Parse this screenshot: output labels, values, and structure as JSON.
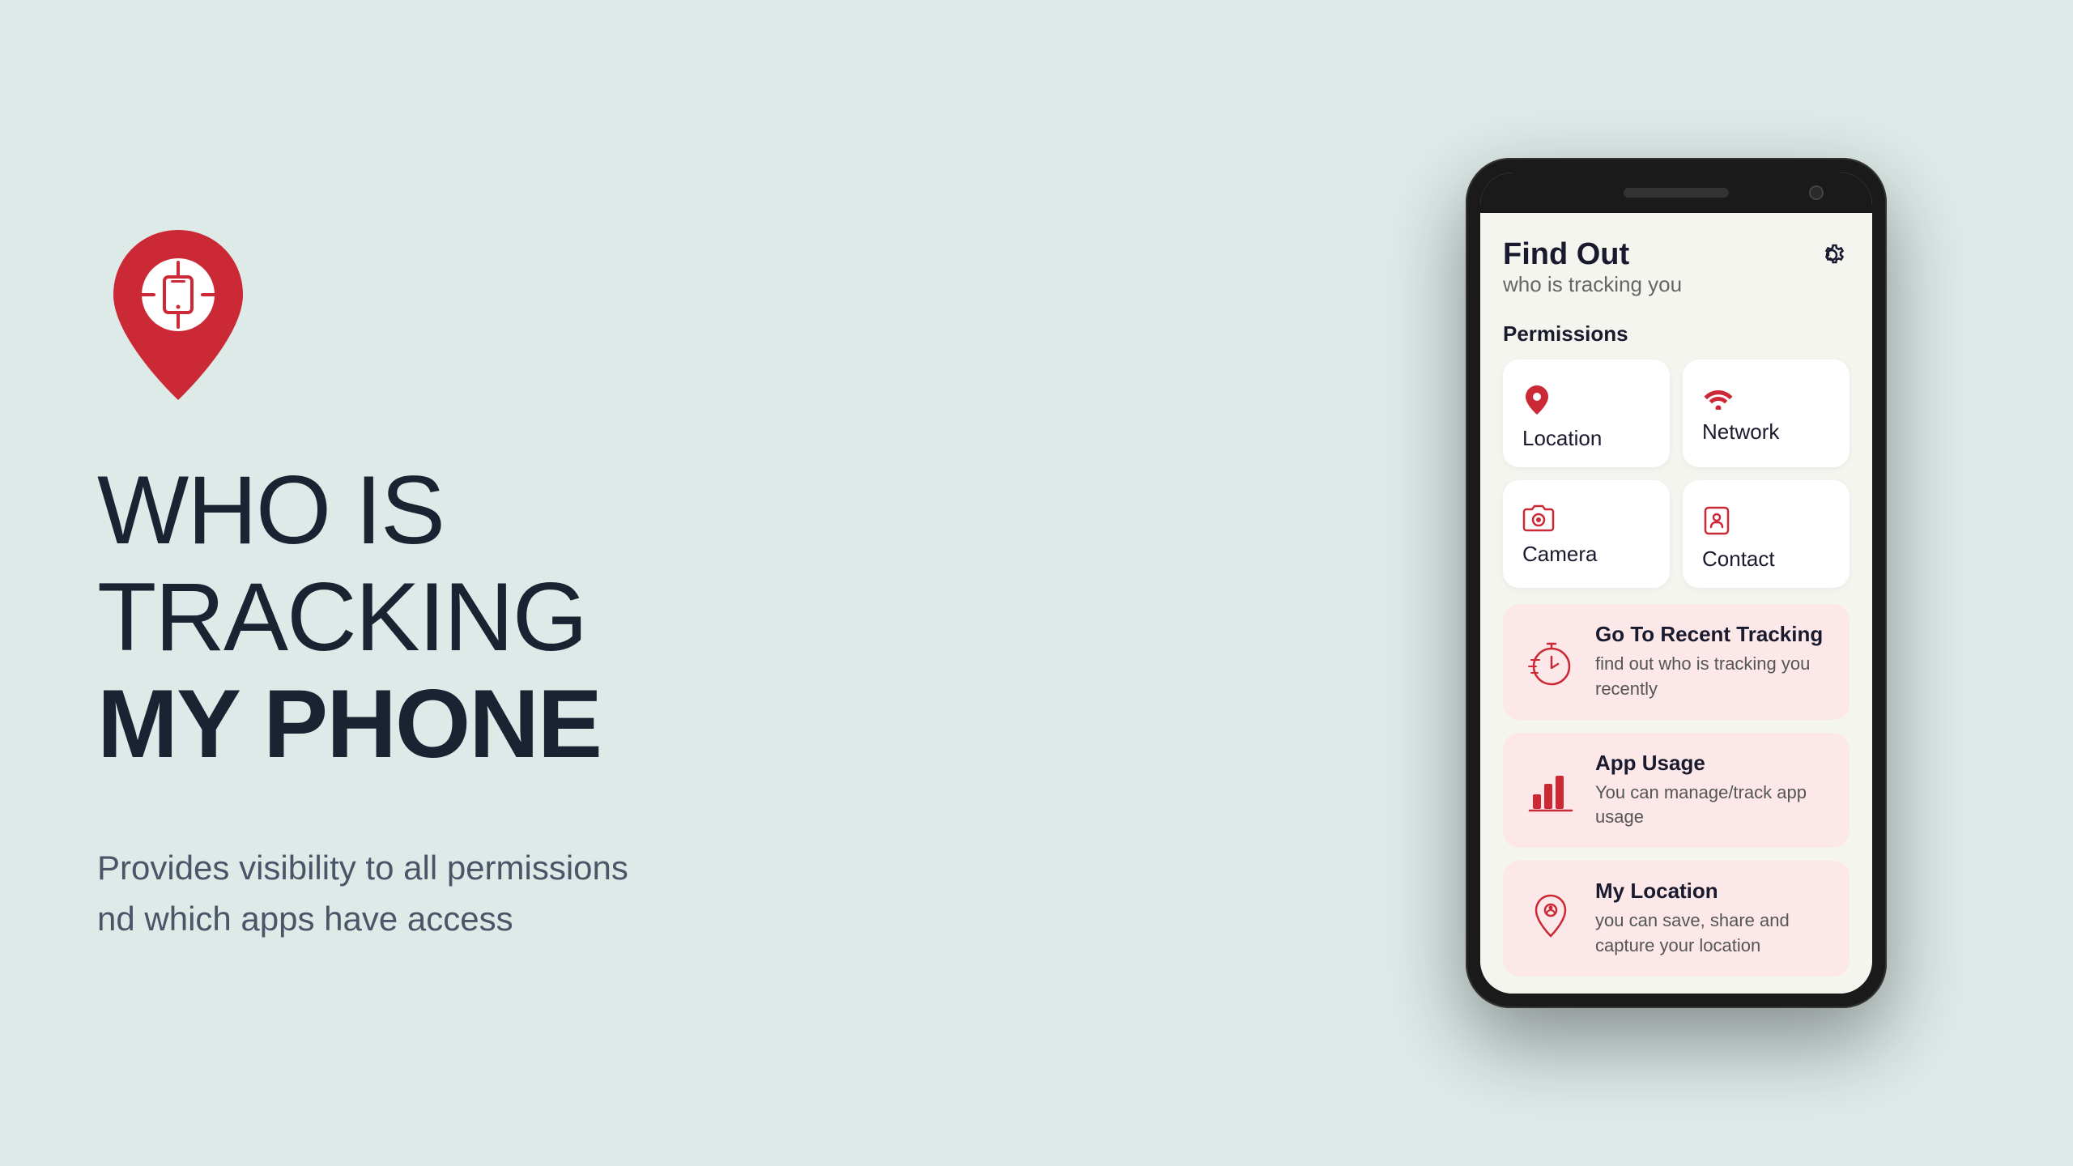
{
  "background_color": "#ddeae8",
  "left": {
    "headline_line1": "WHO IS",
    "headline_line2": "TRACKING",
    "headline_bold": "MY PHONE",
    "subtext": "Provides visibility to all permissions\nnd which apps have access"
  },
  "app": {
    "title": "Find Out",
    "subtitle": "who is tracking you",
    "settings_icon": "gear-icon",
    "permissions_section_label": "Permissions",
    "permissions": [
      {
        "label": "Location",
        "icon": "location-icon"
      },
      {
        "label": "Network",
        "icon": "network-icon"
      },
      {
        "label": "Camera",
        "icon": "camera-icon"
      },
      {
        "label": "Contact",
        "icon": "contact-icon"
      }
    ],
    "features": [
      {
        "title": "Go To Recent Tracking",
        "description": "find out who is tracking you recently",
        "icon": "stopwatch-icon"
      },
      {
        "title": "App Usage",
        "description": "You can manage/track app usage",
        "icon": "chart-icon"
      },
      {
        "title": "My Location",
        "description": "you can save, share and capture your location",
        "icon": "map-icon"
      }
    ]
  }
}
